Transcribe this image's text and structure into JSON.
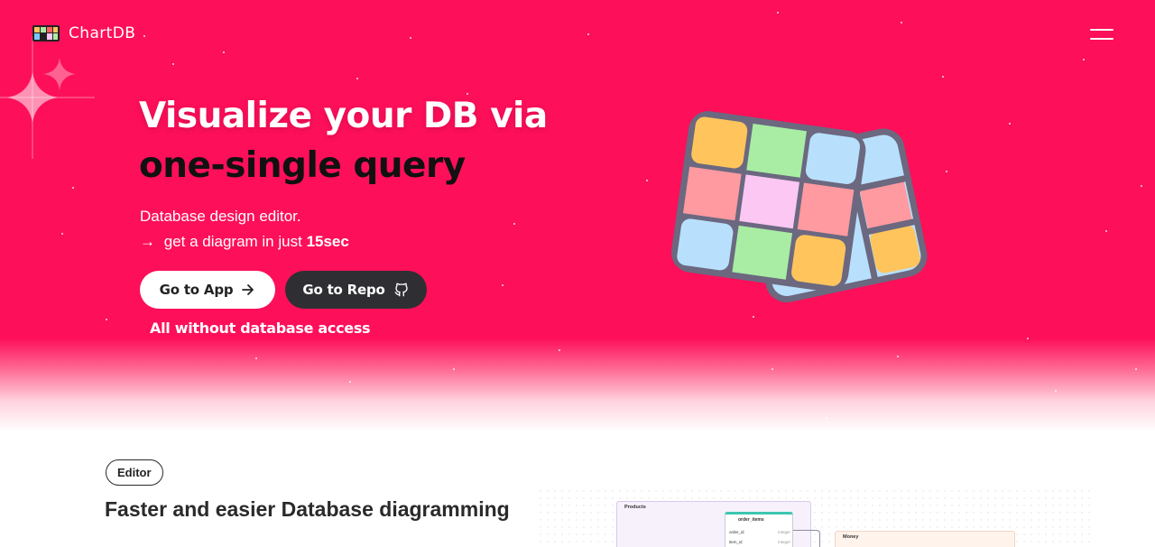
{
  "brand": {
    "name": "ChartDB"
  },
  "nav": {
    "menu_icon": "hamburger-menu-icon"
  },
  "hero": {
    "headline_line1": "Visualize your DB via",
    "headline_line2": "one-single query",
    "subtitle_line1": "Database design editor.",
    "subtitle_line2_arrow": "→",
    "subtitle_line2_text": "get a diagram in just",
    "subtitle_line2_bold": "15sec",
    "btn_app_label": "Go to App",
    "btn_repo_label": "Go to Repo",
    "note": "All without database access"
  },
  "section": {
    "badge": "Editor",
    "title": "Faster and easier Database diagramming"
  },
  "preview": {
    "table_products": "Products",
    "table_order_items": "order_items",
    "rows": [
      {
        "name": "order_id",
        "type": "integer"
      },
      {
        "name": "item_id",
        "type": "integer"
      }
    ],
    "table_money": "Money"
  },
  "colors": {
    "hero_bg": "#fd0f5a",
    "repo_button": "#2f2f33",
    "grid_yellow": "#ffc55c",
    "grid_green": "#a8eda3",
    "grid_blue": "#b8e0fc",
    "grid_red": "#ff9aa0",
    "grid_pink": "#fcc7f3",
    "grid_border": "#6b6880"
  }
}
